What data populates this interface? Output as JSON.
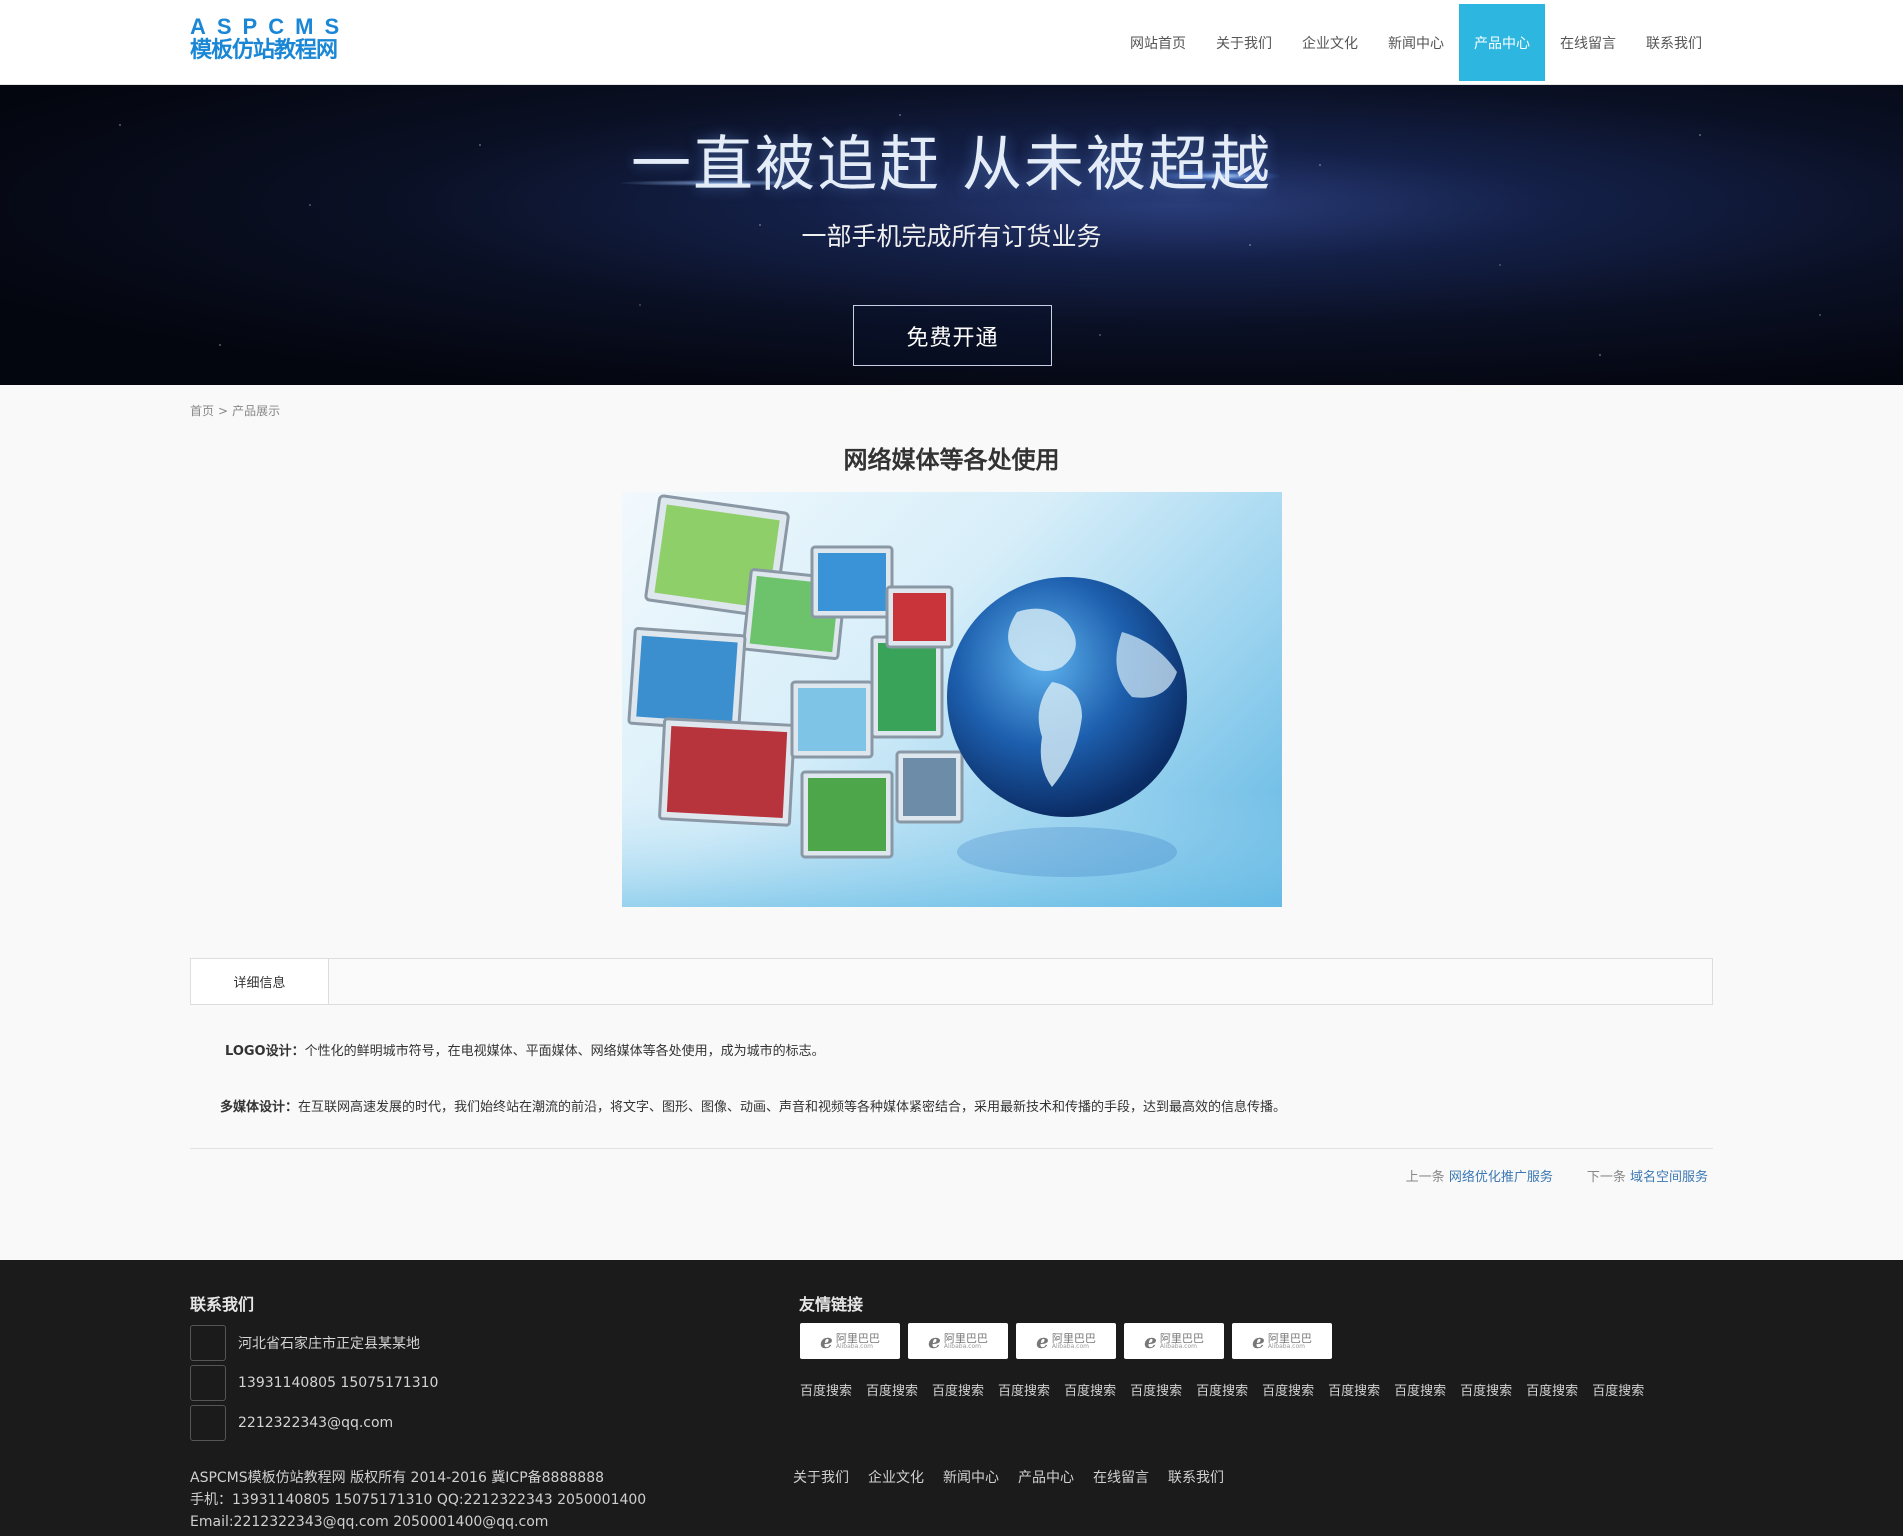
{
  "logo": {
    "top": "ASPCMS",
    "bottom": "模板仿站教程网"
  },
  "nav": [
    {
      "label": "网站首页"
    },
    {
      "label": "关于我们"
    },
    {
      "label": "企业文化"
    },
    {
      "label": "新闻中心"
    },
    {
      "label": "产品中心",
      "active": true
    },
    {
      "label": "在线留言"
    },
    {
      "label": "联系我们"
    }
  ],
  "banner": {
    "title": "一直被追赶 从未被超越",
    "subtitle": "一部手机完成所有订货业务",
    "button": "免费开通"
  },
  "breadcrumb": {
    "home": "首页",
    "separator": ">",
    "current": "产品展示"
  },
  "product": {
    "title": "网络媒体等各处使用",
    "image_icon": "globe-screens-image"
  },
  "tabs": {
    "detail": "详细信息"
  },
  "description": [
    {
      "label": "LOGO设计：",
      "text": "个性化的鲜明城市符号，在电视媒体、平面媒体、网络媒体等各处使用，成为城市的标志。"
    },
    {
      "label": "多媒体设计：",
      "text": "在互联网高速发展的时代，我们始终站在潮流的前沿，将文字、图形、图像、动画、声音和视频等各种媒体紧密结合，采用最新技术和传播的手段，达到最高效的信息传播。"
    }
  ],
  "prev": {
    "label": "上一条",
    "link": "网络优化推广服务"
  },
  "next": {
    "label": "下一条",
    "link": "域名空间服务"
  },
  "footer": {
    "contact_heading": "联系我们",
    "address": "河北省石家庄市正定县某某地",
    "phone": "13931140805 15075171310",
    "email": "2212322343@qq.com",
    "links_heading": "友情链接",
    "partner_logo": {
      "mark": "e",
      "cn": "阿里巴巴",
      "en": "Alibaba.com"
    },
    "partner_logo_count": 5,
    "friend_links": [
      "百度搜索",
      "百度搜索",
      "百度搜索",
      "百度搜索",
      "百度搜索",
      "百度搜索",
      "百度搜索",
      "百度搜索",
      "百度搜索",
      "百度搜索",
      "百度搜索",
      "百度搜索",
      "百度搜索"
    ],
    "copyright_lines": [
      "ASPCMS模板仿站教程网 版权所有 2014-2016 冀ICP备8888888",
      "手机：13931140805 15075171310 QQ:2212322343 2050001400",
      "Email:2212322343@qq.com 2050001400@qq.com"
    ],
    "nav": [
      "关于我们",
      "企业文化",
      "新闻中心",
      "产品中心",
      "在线留言",
      "联系我们"
    ]
  },
  "colors": {
    "accent": "#2db7e0",
    "logo": "#1a87d6",
    "footer_bg": "#1b1b1b",
    "link": "#3c78b4"
  }
}
